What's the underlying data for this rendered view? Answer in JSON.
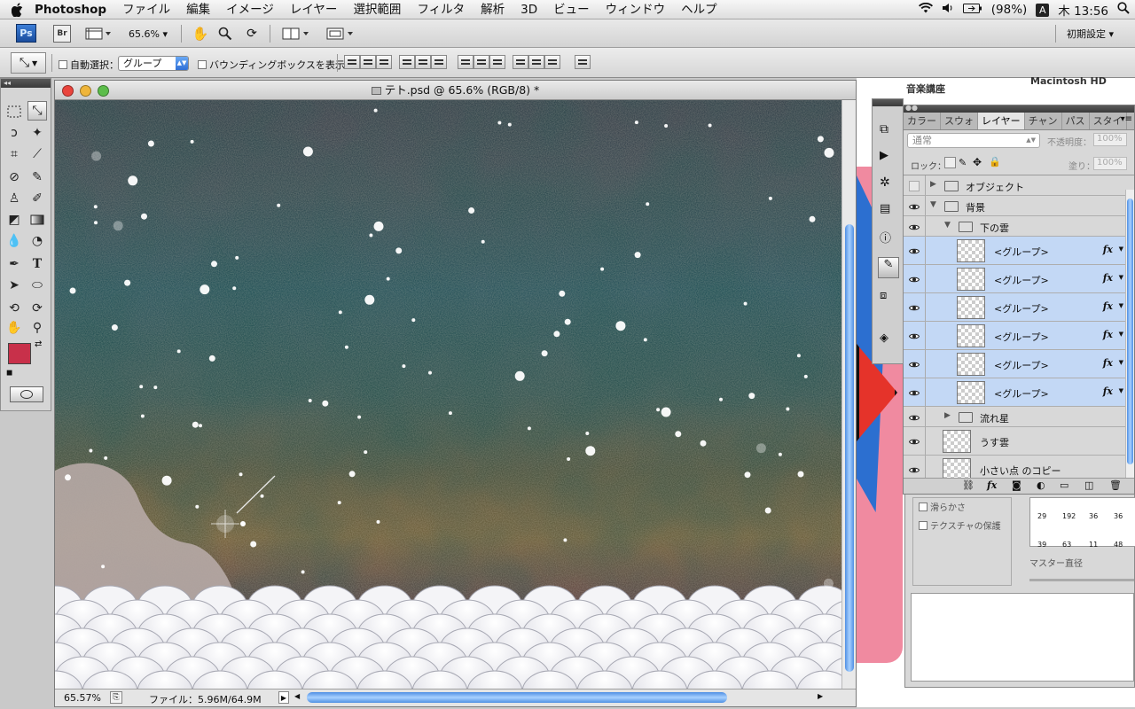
{
  "menubar": {
    "app_name": "Photoshop",
    "items": [
      "ファイル",
      "編集",
      "イメージ",
      "レイヤー",
      "選択範囲",
      "フィルタ",
      "解析",
      "3D",
      "ビュー",
      "ウィンドウ",
      "ヘルプ"
    ],
    "battery": "(98%)",
    "input_indicator": "A",
    "clock": "木 13:56"
  },
  "appbar": {
    "logo": "Ps",
    "bridge": "Br",
    "zoom": "65.6%",
    "workspace": "初期設定"
  },
  "options": {
    "auto_select_label": "自動選択：",
    "auto_select_value": "グループ",
    "bounding_box_label": "バウンディングボックスを表示"
  },
  "document": {
    "title": "テト.psd @ 65.6% (RGB/8) *",
    "zoom_status": "65.57%",
    "file_info": "ファイル：5.96M/64.9M"
  },
  "colors": {
    "foreground": "#c8304a",
    "background": "#000000",
    "accent": "#4f8fe3",
    "selected_row": "#c3d8f5"
  },
  "background_window": {
    "label_1": "音楽講座",
    "label_2": "Macintosh HD"
  },
  "layers_panel": {
    "tabs": [
      "カラー",
      "スウォ",
      "レイヤー",
      "チャン",
      "パス",
      "スタイ"
    ],
    "active_tab": "レイヤー",
    "blend_mode": "通常",
    "opacity_label": "不透明度：",
    "opacity_value": "100%",
    "lock_label": "ロック：",
    "fill_label": "塗り：",
    "fill_value": "100%",
    "rows": [
      {
        "name": "オブジェクト",
        "kind": "folder",
        "indent": 0,
        "expanded": false,
        "visible": false,
        "selected": false
      },
      {
        "name": "背景",
        "kind": "folder",
        "indent": 0,
        "expanded": true,
        "visible": true,
        "selected": false
      },
      {
        "name": "下の雲",
        "kind": "folder",
        "indent": 1,
        "expanded": true,
        "visible": true,
        "selected": false
      },
      {
        "name": "<グループ>",
        "kind": "layer",
        "indent": 2,
        "fx": true,
        "visible": true,
        "selected": true
      },
      {
        "name": "<グループ>",
        "kind": "layer",
        "indent": 2,
        "fx": true,
        "visible": true,
        "selected": true
      },
      {
        "name": "<グループ>",
        "kind": "layer",
        "indent": 2,
        "fx": true,
        "visible": true,
        "selected": true
      },
      {
        "name": "<グループ>",
        "kind": "layer",
        "indent": 2,
        "fx": true,
        "visible": true,
        "selected": true
      },
      {
        "name": "<グループ>",
        "kind": "layer",
        "indent": 2,
        "fx": true,
        "visible": true,
        "selected": true
      },
      {
        "name": "<グループ>",
        "kind": "layer",
        "indent": 2,
        "fx": true,
        "visible": true,
        "selected": true
      },
      {
        "name": "流れ星",
        "kind": "folder",
        "indent": 1,
        "expanded": false,
        "visible": true,
        "selected": false
      },
      {
        "name": "うす雲",
        "kind": "layer",
        "indent": 0,
        "fx": false,
        "visible": true,
        "selected": false
      },
      {
        "name": "小さい点 のコピー",
        "kind": "layer",
        "indent": 0,
        "fx": false,
        "visible": true,
        "selected": false
      }
    ],
    "fx_label": "fx"
  },
  "brush_panel": {
    "smoothing": "滑らかさ",
    "texture_protect": "テクスチャの保護",
    "master_diameter": "マスター直径",
    "sizes": [
      "29",
      "192",
      "36",
      "36",
      "39",
      "63",
      "11",
      "48"
    ]
  }
}
